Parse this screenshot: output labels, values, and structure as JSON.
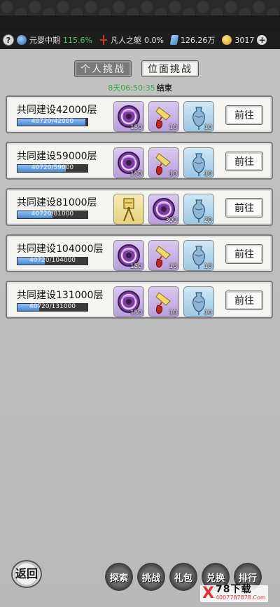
{
  "statusbar": {
    "help": "?",
    "realm": "元婴中期",
    "realm_pct": "115.6%",
    "body": "凡人之躯",
    "body_pct": "0.0%",
    "gems": "126.26万",
    "coins": "3017",
    "add": "+"
  },
  "tabs": {
    "personal": "个人挑战",
    "plane": "位面挑战"
  },
  "timer": {
    "countdown": "8天06:50:35",
    "end_label": "结束"
  },
  "rows": [
    {
      "title": "共同建设42000层",
      "progress_text": "40720/42000",
      "progress": 0.97,
      "items": [
        {
          "icon": "purple-orb-icon",
          "count": "150",
          "bg": "purple"
        },
        {
          "icon": "red-gourd-icon",
          "count": "10",
          "bg": "purple"
        },
        {
          "icon": "blue-vase-icon",
          "count": "10",
          "bg": "blue"
        }
      ],
      "button": "前往"
    },
    {
      "title": "共同建设59000层",
      "progress_text": "40720/59000",
      "progress": 0.69,
      "items": [
        {
          "icon": "purple-orb-icon",
          "count": "150",
          "bg": "purple"
        },
        {
          "icon": "red-gourd-icon",
          "count": "10",
          "bg": "purple"
        },
        {
          "icon": "blue-vase-icon",
          "count": "10",
          "bg": "blue"
        }
      ],
      "button": "前往"
    },
    {
      "title": "共同建设81000层",
      "progress_text": "40720/81000",
      "progress": 0.5,
      "items": [
        {
          "icon": "golden-staff-icon",
          "count": "",
          "bg": "yellow"
        },
        {
          "icon": "purple-orb-icon",
          "count": "300",
          "bg": "purple"
        },
        {
          "icon": "blue-vase-icon",
          "count": "20",
          "bg": "blue"
        }
      ],
      "button": "前往"
    },
    {
      "title": "共同建设104000层",
      "progress_text": "40720/104000",
      "progress": 0.39,
      "items": [
        {
          "icon": "purple-orb-icon",
          "count": "150",
          "bg": "purple"
        },
        {
          "icon": "red-gourd-icon",
          "count": "10",
          "bg": "purple"
        },
        {
          "icon": "blue-vase-icon",
          "count": "10",
          "bg": "blue"
        }
      ],
      "button": "前往"
    },
    {
      "title": "共同建设131000层",
      "progress_text": "40720/131000",
      "progress": 0.31,
      "items": [
        {
          "icon": "purple-orb-icon",
          "count": "150",
          "bg": "purple"
        },
        {
          "icon": "red-gourd-icon",
          "count": "10",
          "bg": "purple"
        },
        {
          "icon": "blue-vase-icon",
          "count": "10",
          "bg": "blue"
        }
      ],
      "button": "前往"
    }
  ],
  "bottom": {
    "back": "返回",
    "nav": [
      "探索",
      "挑战",
      "礼包",
      "兑换",
      "排行"
    ]
  },
  "watermark": {
    "main": "78下载",
    "sub": "4007787878.Com"
  },
  "colors": {
    "progress_fill": "#4a88d4",
    "timer_green": "#38a64a",
    "stat_green": "#4fc86a"
  }
}
